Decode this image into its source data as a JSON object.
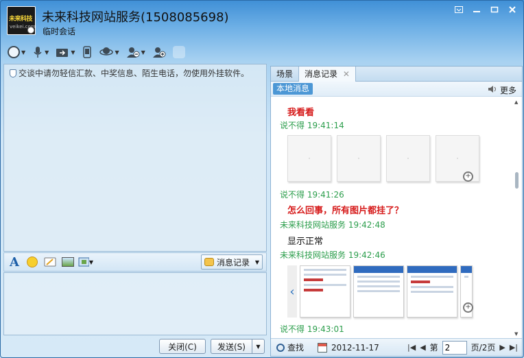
{
  "header": {
    "title": "未来科技网站服务(1508085698)",
    "subtitle": "临时会话",
    "avatar_brand": "未来科技",
    "avatar_url": "veikei.com"
  },
  "notice": "交谈中请勿轻信汇款、中奖信息、陌生电话，勿使用外挂软件。",
  "format_bar": {
    "history_label": "消息记录"
  },
  "actions": {
    "close_label": "关闭(C)",
    "send_label": "发送(S)"
  },
  "right_panel": {
    "tabs": [
      {
        "label": "场景"
      },
      {
        "label": "消息记录"
      }
    ],
    "local_label": "本地消息",
    "more_label": "更多",
    "messages": [
      {
        "text": "我看看"
      },
      {
        "sender": "说不得 19:41:14"
      },
      {
        "sender": "说不得 19:41:26"
      },
      {
        "text": "怎么回事，所有图片都挂了？"
      },
      {
        "sender": "未来科技网站服务 19:42:48"
      },
      {
        "text": "显示正常"
      },
      {
        "sender": "未来科技网站服务 19:42:46"
      },
      {
        "sender": "说不得 19:43:01"
      }
    ],
    "footer": {
      "find_label": "查找",
      "date": "2012-11-17",
      "page_prefix": "第",
      "page_value": "2",
      "page_suffix": "页/2页"
    }
  },
  "colors": {
    "sender_green": "#2c9e4c",
    "alert_red": "#d61b1b",
    "accent_blue": "#4c97d5"
  }
}
